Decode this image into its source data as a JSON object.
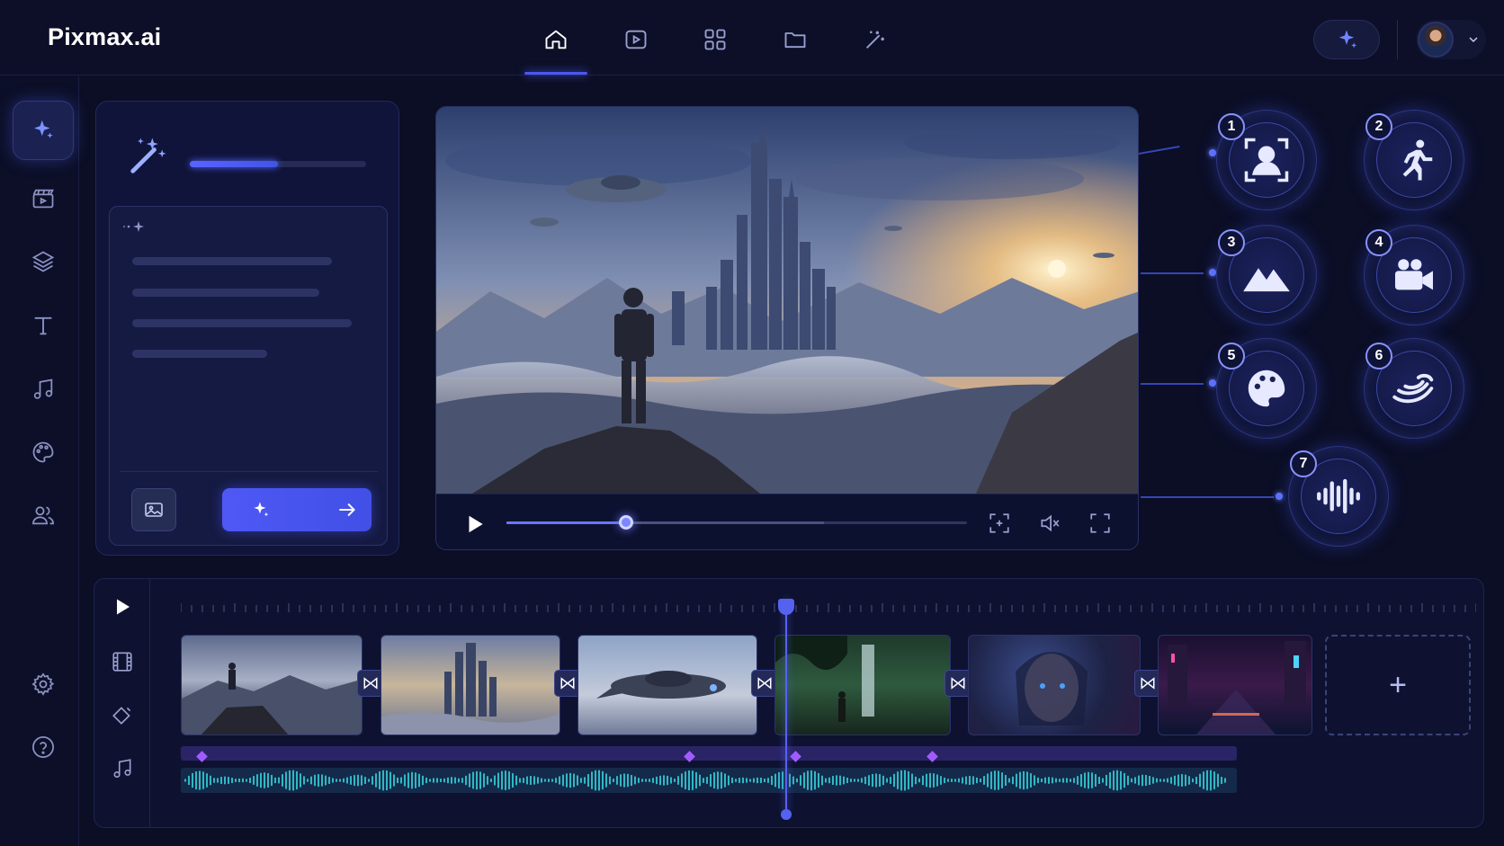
{
  "app": {
    "name": "Pixmax.ai"
  },
  "nav": {
    "items": [
      {
        "name": "home-icon",
        "active": true
      },
      {
        "name": "video-play-icon",
        "active": false
      },
      {
        "name": "grid-icon",
        "active": false
      },
      {
        "name": "folder-icon",
        "active": false
      },
      {
        "name": "magic-wand-icon",
        "active": false
      }
    ]
  },
  "header": {
    "ai_button_icon": "sparkles-icon",
    "profile_menu_icon": "chevron-down-icon"
  },
  "sidebar": {
    "items": [
      {
        "name": "sparkles-icon",
        "active": true
      },
      {
        "name": "clapperboard-icon",
        "active": false
      },
      {
        "name": "layers-icon",
        "active": false
      },
      {
        "name": "text-icon",
        "active": false
      },
      {
        "name": "music-icon",
        "active": false
      },
      {
        "name": "palette-icon",
        "active": false
      },
      {
        "name": "users-icon",
        "active": false
      }
    ],
    "bottom": [
      {
        "name": "settings-icon"
      },
      {
        "name": "help-icon"
      }
    ]
  },
  "prompt_panel": {
    "progress": 0.5,
    "upload_icon": "image-icon",
    "generate_icons": [
      "sparkles-icon",
      "arrow-right-icon"
    ]
  },
  "player": {
    "progress": 0.26,
    "buffered": 0.69,
    "controls": [
      "focus-icon",
      "mute-icon",
      "fullscreen-icon"
    ]
  },
  "features": [
    {
      "number": "1",
      "icon": "person-frame-icon"
    },
    {
      "number": "2",
      "icon": "running-icon"
    },
    {
      "number": "3",
      "icon": "mountains-icon"
    },
    {
      "number": "4",
      "icon": "video-camera-icon"
    },
    {
      "number": "5",
      "icon": "palette-icon"
    },
    {
      "number": "6",
      "icon": "motion-swirl-icon"
    },
    {
      "number": "7",
      "icon": "audio-wave-icon"
    }
  ],
  "timeline": {
    "clips": [
      "explorer-on-cliff",
      "futuristic-city",
      "spaceship",
      "jungle-waterfall",
      "portrait-woman",
      "neon-street"
    ],
    "add_label": "+",
    "playhead": 0.44
  },
  "colors": {
    "accent": "#4f58f5",
    "background": "#0b0e24",
    "panel": "#10143a"
  }
}
